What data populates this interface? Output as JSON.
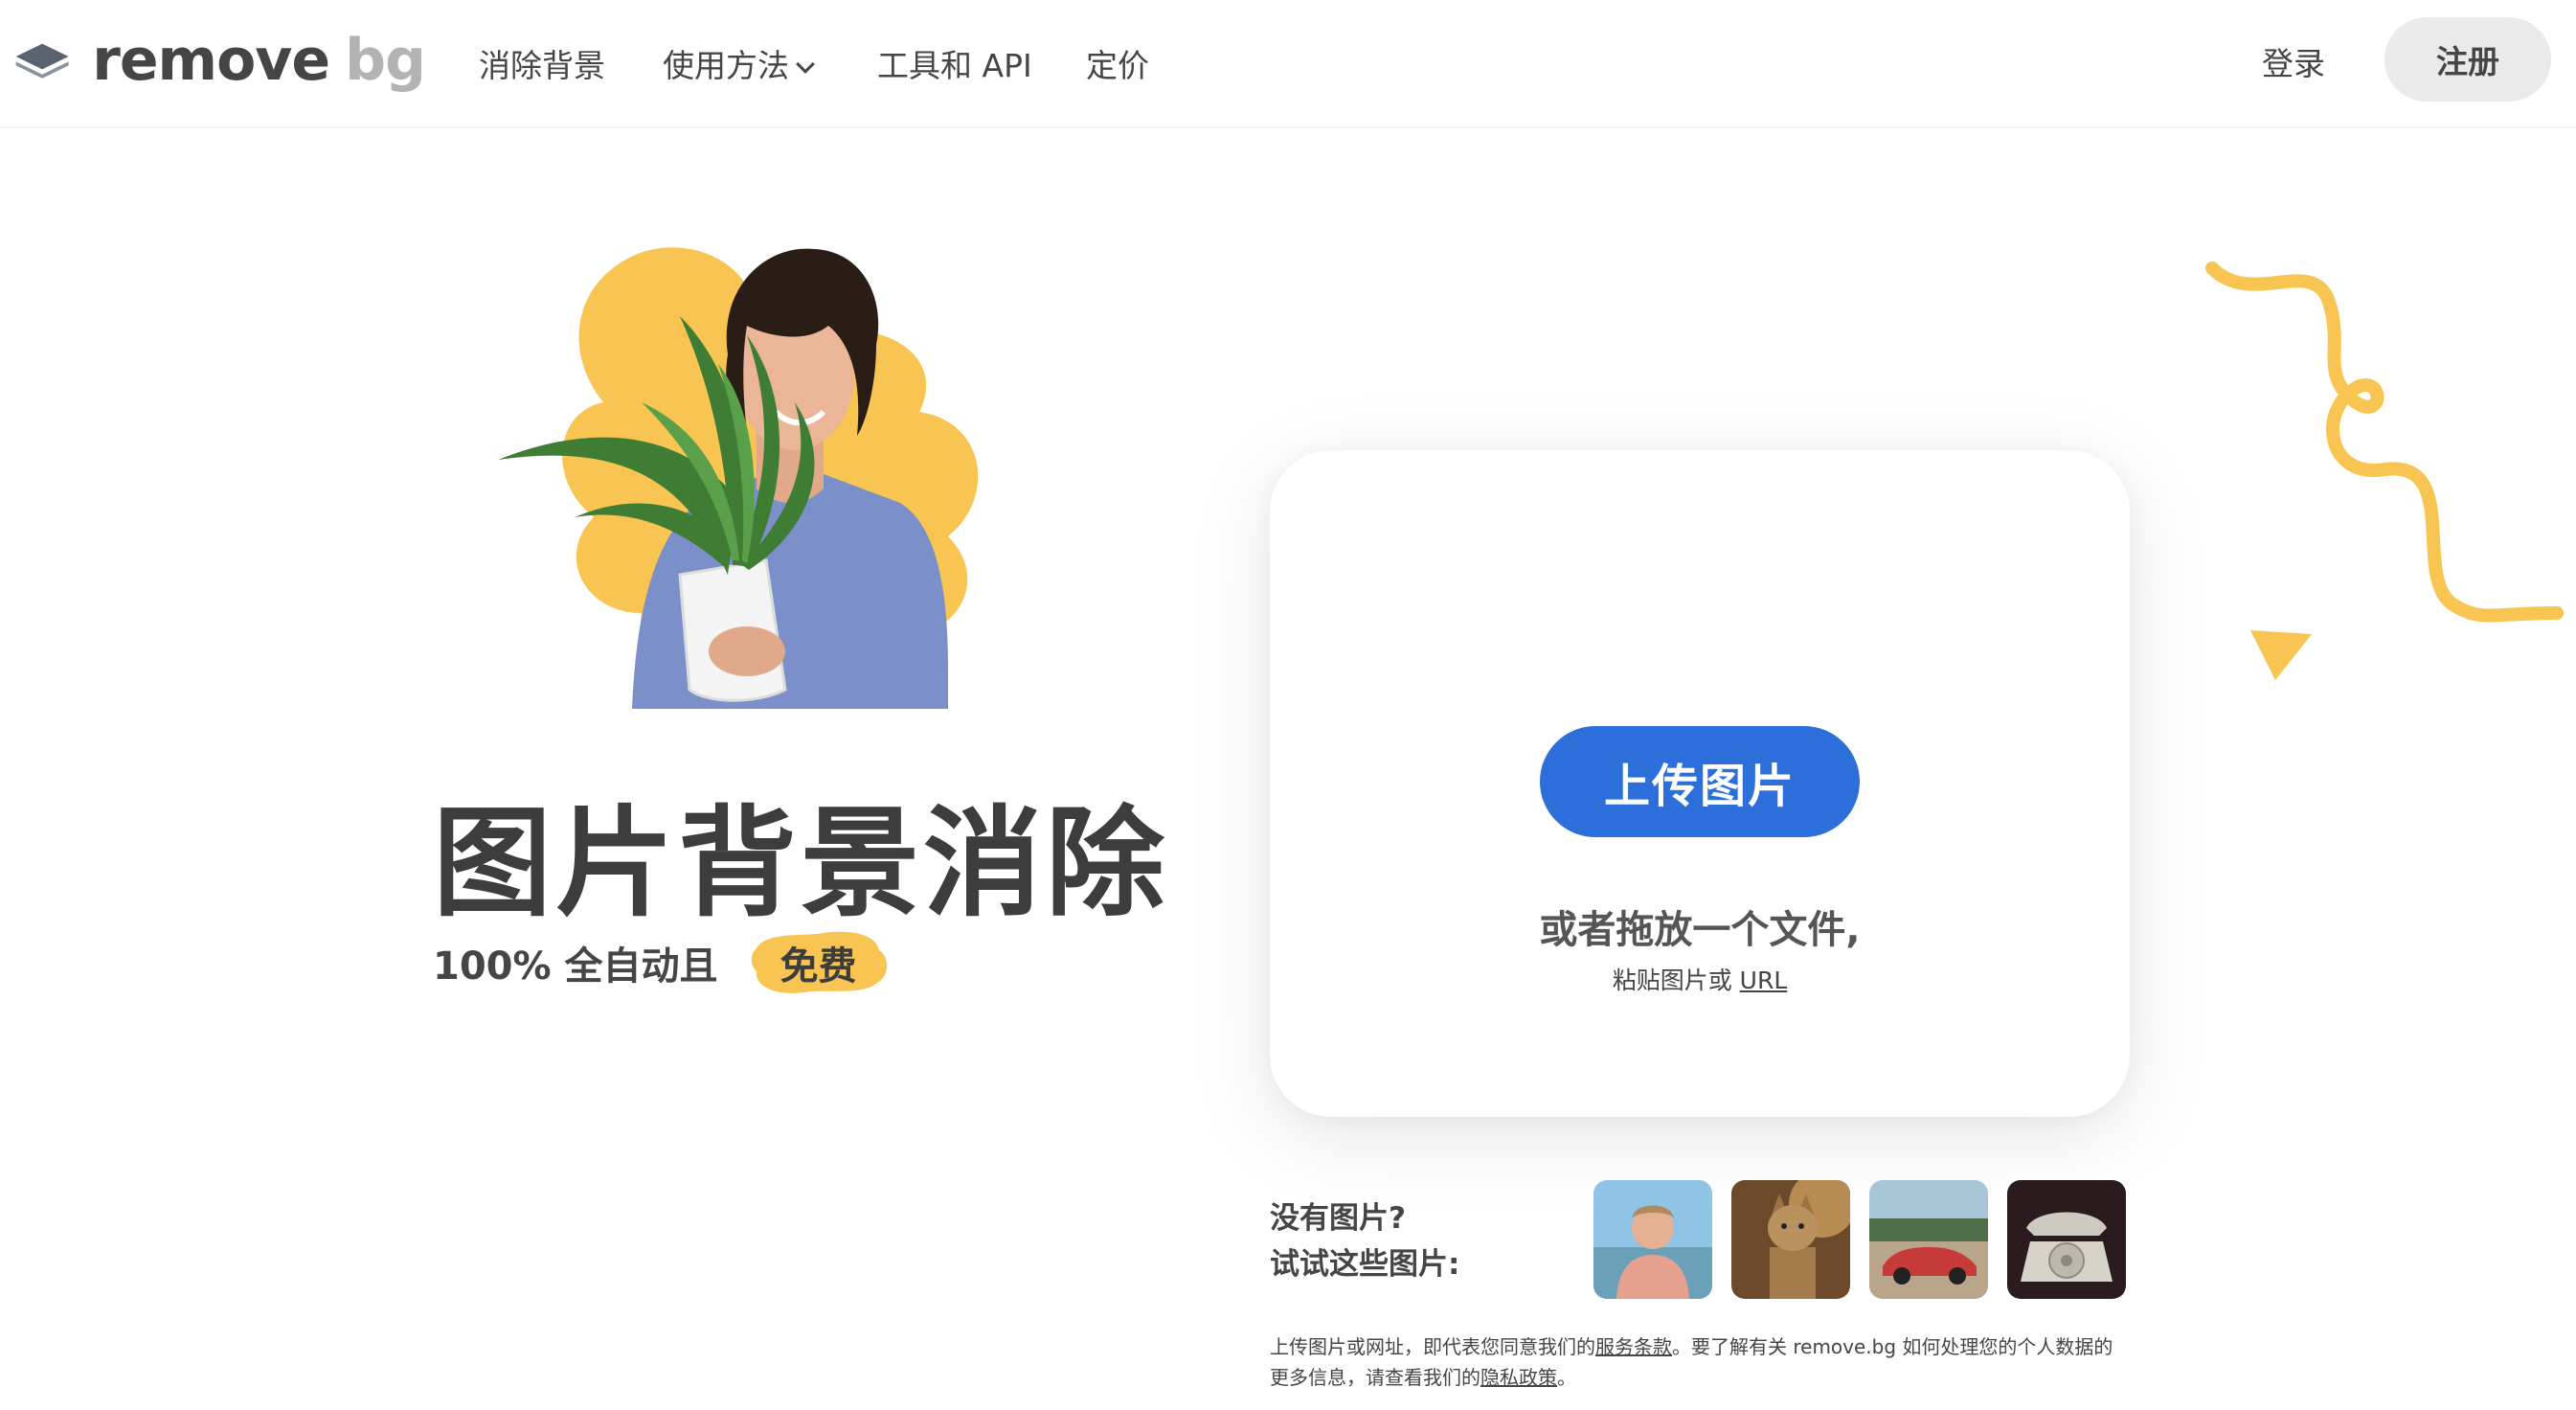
{
  "header": {
    "logo_text_1": "remove",
    "logo_text_2": "bg",
    "nav": {
      "remove_bg": "消除背景",
      "how_to": "使用方法",
      "tools_api": "工具和 API",
      "pricing": "定价"
    },
    "login": "登录",
    "signup": "注册"
  },
  "hero": {
    "title": "图片背景消除",
    "subtitle": "100% 全自动且",
    "badge": "免费"
  },
  "upload": {
    "button": "上传图片",
    "drop_text": "或者拖放一个文件,",
    "paste_text": "粘贴图片或",
    "paste_url": "URL"
  },
  "samples": {
    "line1": "没有图片?",
    "line2": "试试这些图片:",
    "items": [
      "person-sample-icon",
      "cat-sample-icon",
      "car-sample-icon",
      "telephone-sample-icon"
    ]
  },
  "legal": {
    "text1": "上传图片或网址，即代表您同意我们的",
    "terms": "服务条款",
    "text2": "。要了解有关 remove.bg 如何处理您的个人数据的更多信息，请查看我们的",
    "privacy": "隐私政策",
    "text3": "。"
  },
  "colors": {
    "accent_blue": "#2c6fdb",
    "accent_yellow": "#f8c452",
    "text_dark": "#454545"
  }
}
